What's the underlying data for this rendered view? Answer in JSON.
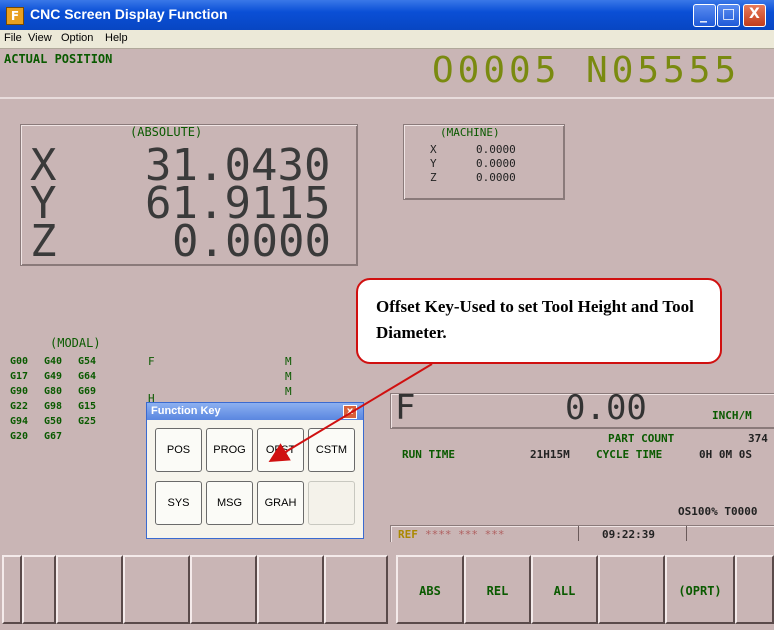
{
  "window": {
    "title": "CNC Screen Display Function",
    "icon": "app-icon",
    "minimize_glyph": "_",
    "maximize_glyph": "□",
    "close_glyph": "X"
  },
  "menu": [
    "File",
    "View",
    "Option",
    "Help"
  ],
  "screen": {
    "section_title": "ACTUAL POSITION",
    "program_number": "O0005 N05555",
    "absolute": {
      "title": "(ABSOLUTE)",
      "axes": [
        {
          "axis": "X",
          "value": "31.0430"
        },
        {
          "axis": "Y",
          "value": "61.9115"
        },
        {
          "axis": "Z",
          "value": "0.0000"
        }
      ]
    },
    "machine": {
      "title": "(MACHINE)",
      "axes": [
        {
          "axis": "X",
          "value": "0.0000"
        },
        {
          "axis": "Y",
          "value": "0.0000"
        },
        {
          "axis": "Z",
          "value": "0.0000"
        }
      ]
    },
    "modal": {
      "title": "(MODAL)",
      "rows": [
        [
          "G00",
          "G40",
          "G54"
        ],
        [
          "G17",
          "G49",
          "G64"
        ],
        [
          "G90",
          "G80",
          "G69"
        ],
        [
          "G22",
          "G98",
          "G15"
        ],
        [
          "G94",
          "G50",
          "G25"
        ],
        [
          "G20",
          "G67",
          ""
        ]
      ],
      "f_label": "F",
      "m_labels": [
        "M",
        "M",
        "M"
      ],
      "h_label": "H"
    },
    "feed": {
      "label": "F",
      "value": "0.00",
      "unit": "INCH/M"
    },
    "part_count": {
      "label": "PART COUNT",
      "value": "374"
    },
    "run_time": {
      "label": "RUN TIME",
      "value": "21H15M"
    },
    "cycle_time": {
      "label": "CYCLE TIME",
      "value": "0H 0M 0S"
    },
    "override": "OS100% T0000",
    "status": {
      "mode": "REF",
      "stars": "**** *** ***",
      "clock": "09:22:39"
    }
  },
  "softkeys": [
    "",
    "",
    "",
    "",
    "",
    "",
    "ABS",
    "REL",
    "ALL",
    "",
    "(OPRT)",
    ""
  ],
  "function_key_window": {
    "title": "Function Key",
    "close_glyph": "x",
    "buttons": [
      [
        "POS",
        "PROG",
        "OFST",
        "CSTM"
      ],
      [
        "SYS",
        "MSG",
        "GRAH",
        ""
      ]
    ]
  },
  "callout": {
    "text": "Offset Key-Used to set Tool Height and Tool Diameter.",
    "border_color": "#d01010"
  }
}
